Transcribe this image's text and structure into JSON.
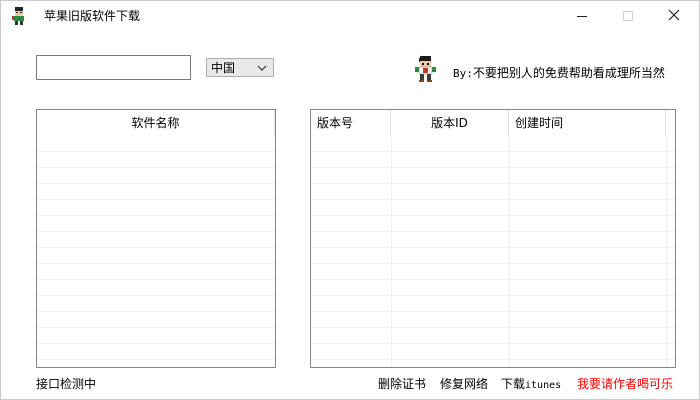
{
  "window": {
    "title": "苹果旧版软件下载",
    "icon": "mascot-icon"
  },
  "search": {
    "value": "",
    "placeholder": ""
  },
  "region": {
    "selected": "中国"
  },
  "author": {
    "prefix": "By:",
    "note": "不要把别人的免费帮助看成理所当然"
  },
  "left_list": {
    "columns": [
      "软件名称"
    ],
    "rows": []
  },
  "right_list": {
    "columns": [
      "版本号",
      "版本ID",
      "创建时间"
    ],
    "rows": []
  },
  "status": {
    "text": "接口检测中"
  },
  "footer": {
    "delete_cert": "删除证书",
    "repair_network": "修复网络",
    "download_prefix": "下载",
    "download_itunes": "itunes",
    "donate": "我要请作者喝可乐"
  },
  "colors": {
    "donate": "#ff0000",
    "panel_border": "#828790"
  }
}
